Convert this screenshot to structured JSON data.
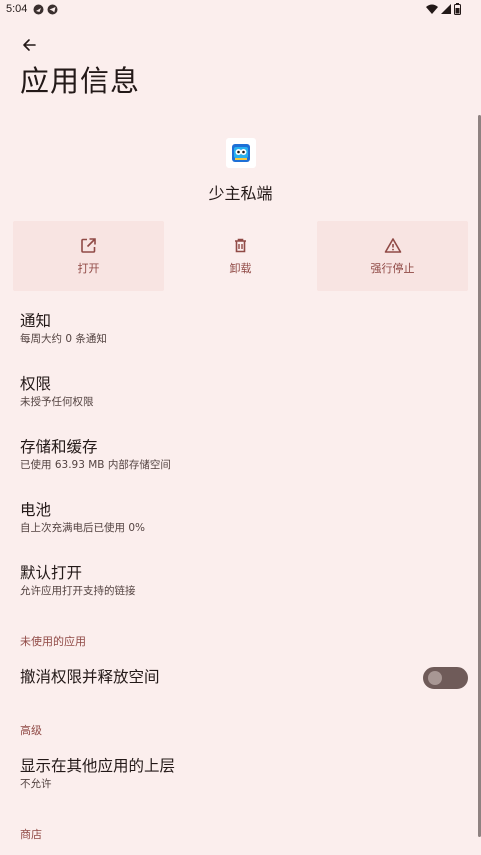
{
  "status_bar": {
    "time": "5:04",
    "left_icons": [
      "notification-icon",
      "telegram-icon"
    ],
    "right_icons": [
      "wifi-icon",
      "signal-icon",
      "battery-icon"
    ]
  },
  "header": {
    "back_icon": "arrow-back-icon",
    "title": "应用信息"
  },
  "app": {
    "icon": "app-icon",
    "name": "少主私端"
  },
  "actions": [
    {
      "label": "打开",
      "icon": "open-in-new-icon"
    },
    {
      "label": "卸载",
      "icon": "trash-icon"
    },
    {
      "label": "强行停止",
      "icon": "warning-icon"
    }
  ],
  "items": {
    "notifications": {
      "title": "通知",
      "subtitle": "每周大约 0 条通知"
    },
    "permissions": {
      "title": "权限",
      "subtitle": "未授予任何权限"
    },
    "storage": {
      "title": "存储和缓存",
      "subtitle": "已使用 63.93 MB 内部存储空间"
    },
    "battery": {
      "title": "电池",
      "subtitle": "自上次充满电后已使用 0%"
    },
    "open_by_default": {
      "title": "默认打开",
      "subtitle": "允许应用打开支持的链接"
    }
  },
  "unused_section": {
    "header": "未使用的应用",
    "toggle_title": "撤消权限并释放空间",
    "toggle_on": false
  },
  "advanced_section": {
    "header": "高级",
    "display_over": {
      "title": "显示在其他应用的上层",
      "subtitle": "不允许"
    }
  },
  "store_section": {
    "header": "商店"
  },
  "colors": {
    "background": "#fbeeed",
    "accent": "#904a46",
    "button_bg": "#f8e4e2",
    "toggle_track": "#6f5b59"
  }
}
